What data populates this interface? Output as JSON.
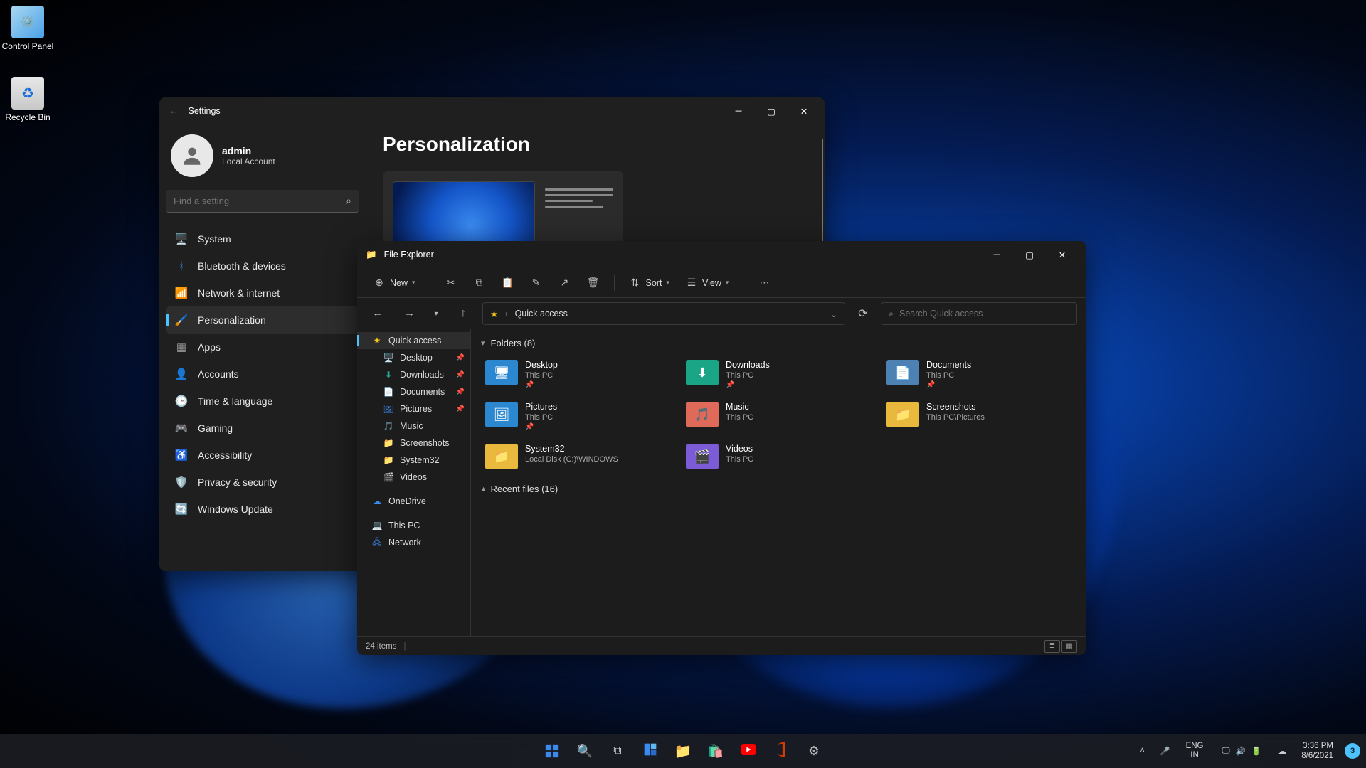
{
  "desktop_icons": [
    {
      "label": "Control Panel"
    },
    {
      "label": "Recycle Bin"
    }
  ],
  "settings": {
    "title": "Settings",
    "user": {
      "name": "admin",
      "account": "Local Account"
    },
    "search_placeholder": "Find a setting",
    "nav": [
      {
        "icon": "🖥️",
        "label": "System"
      },
      {
        "icon": "ᚼ",
        "label": "Bluetooth & devices",
        "color": "#3a8aef"
      },
      {
        "icon": "📶",
        "label": "Network & internet"
      },
      {
        "icon": "🖌️",
        "label": "Personalization",
        "selected": true
      },
      {
        "icon": "▦",
        "label": "Apps",
        "color": "#999"
      },
      {
        "icon": "👤",
        "label": "Accounts"
      },
      {
        "icon": "🕒",
        "label": "Time & language"
      },
      {
        "icon": "🎮",
        "label": "Gaming"
      },
      {
        "icon": "♿",
        "label": "Accessibility"
      },
      {
        "icon": "🛡️",
        "label": "Privacy & security"
      },
      {
        "icon": "🔄",
        "label": "Windows Update"
      }
    ],
    "page_title": "Personalization"
  },
  "explorer": {
    "title": "File Explorer",
    "toolbar": {
      "new": "New",
      "sort": "Sort",
      "view": "View"
    },
    "addr": {
      "location": "Quick access"
    },
    "search_placeholder": "Search Quick access",
    "tree": [
      {
        "icon": "★",
        "label": "Quick access",
        "color": "#f5c518",
        "selected": true
      },
      {
        "icon": "🖥️",
        "label": "Desktop",
        "indent": 1,
        "pin": true,
        "color": "#3a8aef"
      },
      {
        "icon": "⬇",
        "label": "Downloads",
        "indent": 1,
        "pin": true,
        "color": "#26a69a"
      },
      {
        "icon": "📄",
        "label": "Documents",
        "indent": 1,
        "pin": true,
        "color": "#8e99a8"
      },
      {
        "icon": "🖼",
        "label": "Pictures",
        "indent": 1,
        "pin": true,
        "color": "#3a8aef"
      },
      {
        "icon": "🎵",
        "label": "Music",
        "indent": 1,
        "color": "#e57373"
      },
      {
        "icon": "📁",
        "label": "Screenshots",
        "indent": 1,
        "color": "#f5c518"
      },
      {
        "icon": "📁",
        "label": "System32",
        "indent": 1,
        "color": "#f5c518"
      },
      {
        "icon": "🎬",
        "label": "Videos",
        "indent": 1,
        "color": "#7e57c2"
      },
      {
        "gap": true
      },
      {
        "icon": "☁",
        "label": "OneDrive",
        "color": "#3a8aef"
      },
      {
        "gap": true
      },
      {
        "icon": "💻",
        "label": "This PC",
        "color": "#3a8aef"
      },
      {
        "icon": "🖧",
        "label": "Network",
        "color": "#3a8aef"
      }
    ],
    "sections": {
      "folders_head": "Folders (8)",
      "recent_head": "Recent files (16)"
    },
    "folders": [
      {
        "name": "Desktop",
        "path": "This PC",
        "pin": true,
        "bg": "#2a87d0",
        "ic": "🖥"
      },
      {
        "name": "Downloads",
        "path": "This PC",
        "pin": true,
        "bg": "#1aa587",
        "ic": "⬇"
      },
      {
        "name": "Documents",
        "path": "This PC",
        "pin": true,
        "bg": "#4d80b3",
        "ic": "📄"
      },
      {
        "name": "Pictures",
        "path": "This PC",
        "pin": true,
        "bg": "#2a87d0",
        "ic": "🖼"
      },
      {
        "name": "Music",
        "path": "This PC",
        "bg": "#e06a5a",
        "ic": "🎵"
      },
      {
        "name": "Screenshots",
        "path": "This PC\\Pictures",
        "bg": "#e8b93c",
        "ic": "📁"
      },
      {
        "name": "System32",
        "path": "Local Disk (C:)\\WINDOWS",
        "bg": "#e8b93c",
        "ic": "📁"
      },
      {
        "name": "Videos",
        "path": "This PC",
        "bg": "#7b5bd6",
        "ic": "🎬"
      }
    ],
    "status": "24 items"
  },
  "taskbar": {
    "lang": "ENG",
    "lang2": "IN",
    "time": "3:36 PM",
    "date": "8/6/2021",
    "notif": "3"
  }
}
